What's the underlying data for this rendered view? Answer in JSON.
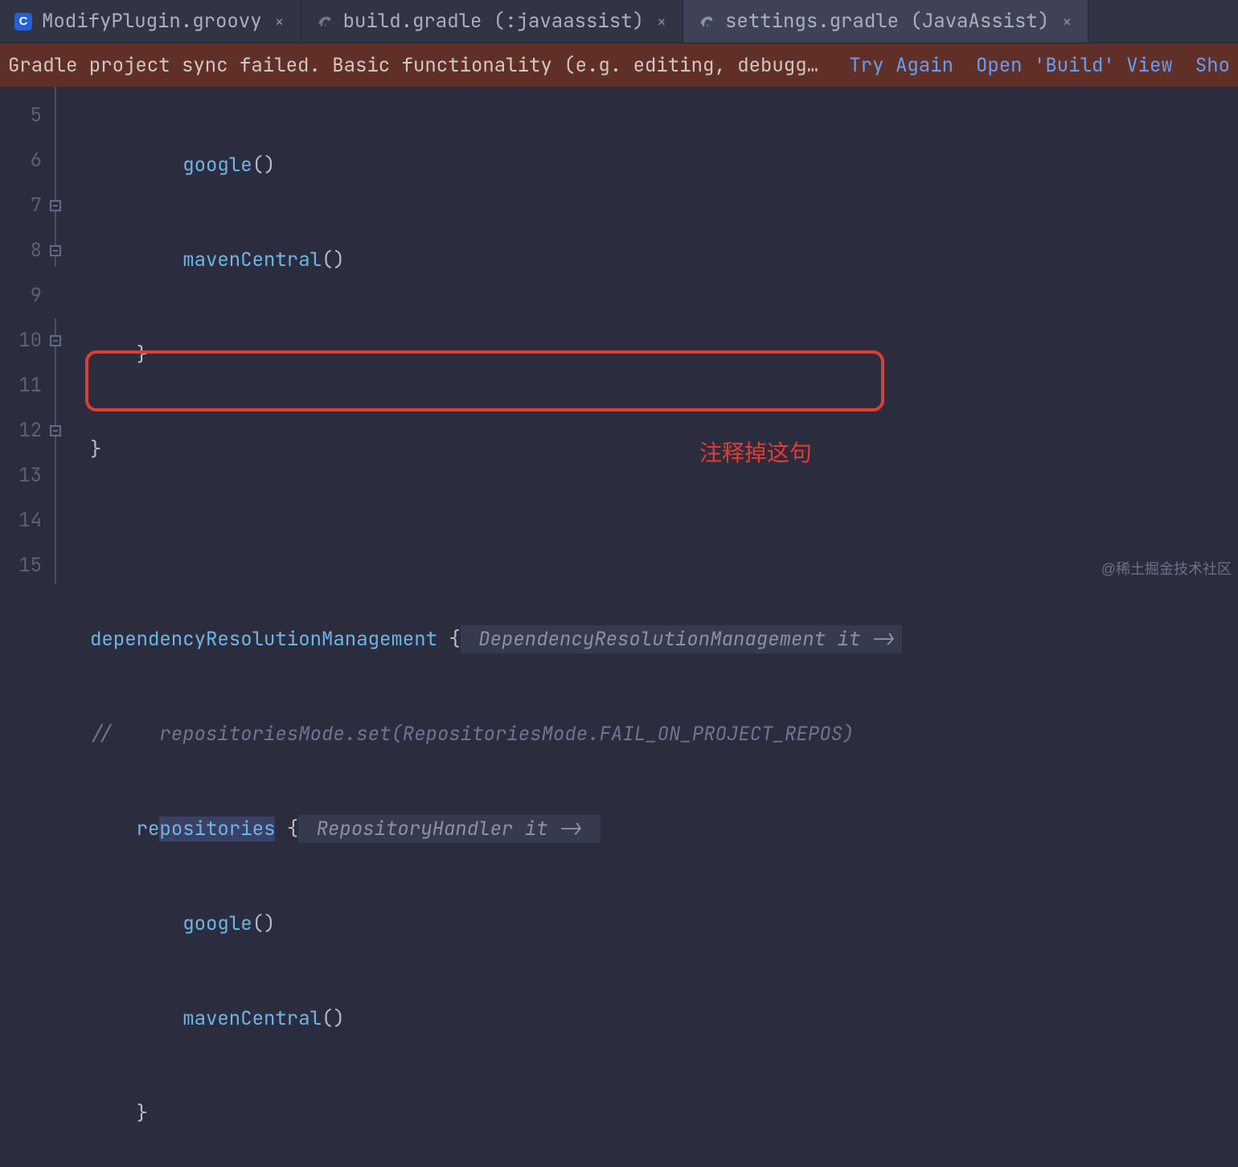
{
  "tabs": [
    {
      "label": "ModifyPlugin.groovy",
      "icon": "groovy-class-icon",
      "active": false
    },
    {
      "label": "build.gradle (:javaassist)",
      "icon": "gradle-icon",
      "active": false
    },
    {
      "label": "settings.gradle (JavaAssist)",
      "icon": "gradle-icon",
      "active": true
    }
  ],
  "banner": {
    "message": "Gradle project sync failed. Basic functionality (e.g. editing, debugging) will not wor...",
    "links": [
      "Try Again",
      "Open 'Build' View",
      "Sho"
    ]
  },
  "gutter_start": 5,
  "gutter_end": 15,
  "code": {
    "l5": {
      "indent": "        ",
      "call": "google",
      "tail": "()"
    },
    "l6": {
      "indent": "        ",
      "call": "mavenCentral",
      "tail": "()"
    },
    "l7": {
      "indent": "    ",
      "brace": "}"
    },
    "l8": {
      "indent": "",
      "brace": "}"
    },
    "l9": {
      "indent": ""
    },
    "l10": {
      "indent": "",
      "call": "dependencyResolutionManagement",
      "brace_open": " {",
      "hint": " DependencyResolutionManagement it ->"
    },
    "l11": {
      "indent": "",
      "comment": "//    repositoriesMode.set(RepositoriesMode.FAIL_ON_PROJECT_REPOS)"
    },
    "l12": {
      "indent": "    ",
      "call_pre": "re",
      "call_sel": "positories",
      "brace_open": " {",
      "hint": " RepositoryHandler it -> "
    },
    "l13": {
      "indent": "        ",
      "call": "google",
      "tail": "()"
    },
    "l14": {
      "indent": "        ",
      "call": "mavenCentral",
      "tail": "()"
    },
    "l15": {
      "indent": "    ",
      "brace": "}"
    }
  },
  "annotation": {
    "label": "注释掉这句"
  },
  "watermark": "@稀土掘金技术社区"
}
